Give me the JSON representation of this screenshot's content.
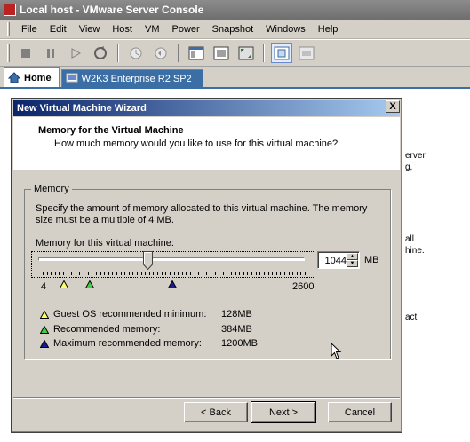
{
  "window": {
    "title": "Local host - VMware Server Console",
    "menu": [
      {
        "label": "File"
      },
      {
        "label": "Edit"
      },
      {
        "label": "View"
      },
      {
        "label": "Host"
      },
      {
        "label": "VM"
      },
      {
        "label": "Power"
      },
      {
        "label": "Snapshot"
      },
      {
        "label": "Windows"
      },
      {
        "label": "Help"
      }
    ],
    "toolbar_icons": [
      "stop-icon",
      "pause-icon",
      "play-icon",
      "reset-icon",
      "snapshot-icon",
      "revert-icon",
      "console-view-icon",
      "fullscreen-icon",
      "quick-switch-icon",
      "summary-view-icon",
      "appliance-view-icon"
    ],
    "tabs": [
      {
        "label": "Home",
        "icon": "home-icon",
        "active": true
      },
      {
        "label": "W2K3 Enterprise R2 SP2",
        "icon": "vm-icon",
        "active": false
      }
    ],
    "background_fragments": [
      "erver",
      "g,",
      "all",
      "hine.",
      "act"
    ]
  },
  "wizard": {
    "title": "New Virtual Machine Wizard",
    "close_label": "X",
    "header_title": "Memory for the Virtual Machine",
    "header_subtitle": "How much memory would you like to use for this virtual machine?",
    "group_label": "Memory",
    "description": "Specify the amount of memory allocated to this virtual machine. The memory size must be a multiple of 4 MB.",
    "slider_label": "Memory for this virtual machine:",
    "memory_value": "1044",
    "memory_unit": "MB",
    "slider": {
      "min": 4,
      "max": 2600,
      "value": 1044
    },
    "scale_min_label": "4",
    "scale_max_label": "2600",
    "markers": {
      "guest_min": 128,
      "recommended": 384,
      "maximum": 1200
    },
    "legend": [
      {
        "label": "Guest OS recommended minimum:",
        "value": "128MB",
        "color": "#ffff66"
      },
      {
        "label": "Recommended memory:",
        "value": "384MB",
        "color": "#44cc44"
      },
      {
        "label": "Maximum recommended memory:",
        "value": "1200MB",
        "color": "#1a1a99"
      }
    ],
    "buttons": {
      "back": "< Back",
      "next": "Next >",
      "cancel": "Cancel"
    }
  }
}
